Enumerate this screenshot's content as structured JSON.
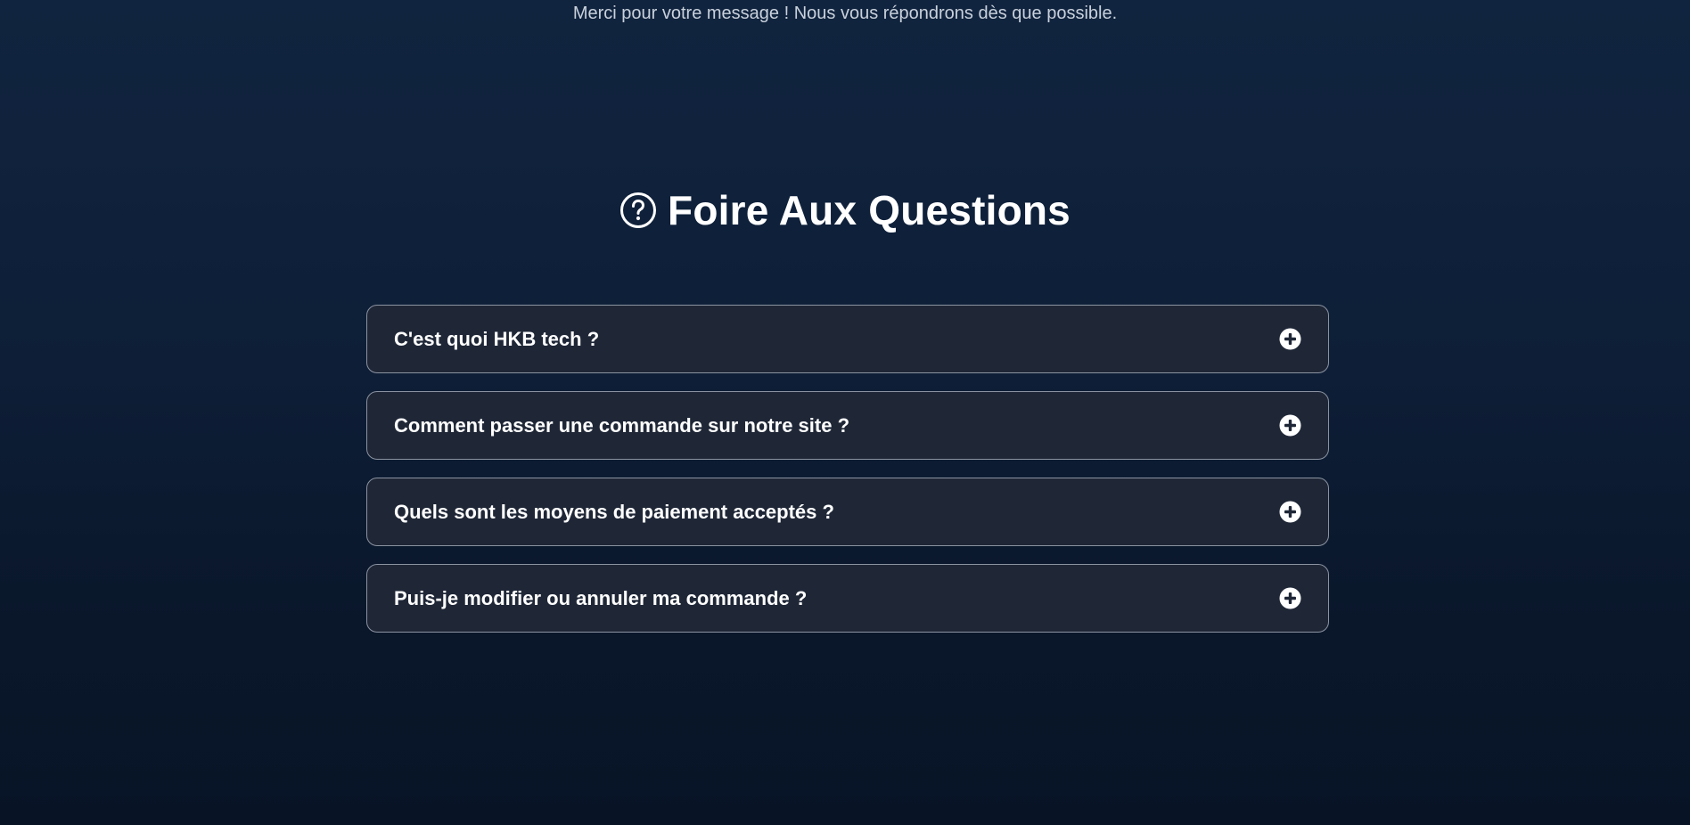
{
  "contact": {
    "thanks_message": "Merci pour votre message ! Nous vous répondrons dès que possible."
  },
  "faq": {
    "title": "Foire Aux Questions",
    "title_icon": "question-circle-icon",
    "toggle_icon": "plus-circle-icon",
    "items": [
      {
        "question": "C'est quoi HKB tech ?"
      },
      {
        "question": "Comment passer une commande sur notre site ?"
      },
      {
        "question": "Quels sont les moyens de paiement acceptés ?"
      },
      {
        "question": "Puis-je modifier ou annuler ma commande ?"
      }
    ]
  },
  "colors": {
    "background_top": "#11243f",
    "background_bottom": "#081426",
    "card_background": "#1f2737",
    "card_border": "#8b93a1",
    "text": "#ffffff",
    "muted_text": "#c9d1dc"
  }
}
